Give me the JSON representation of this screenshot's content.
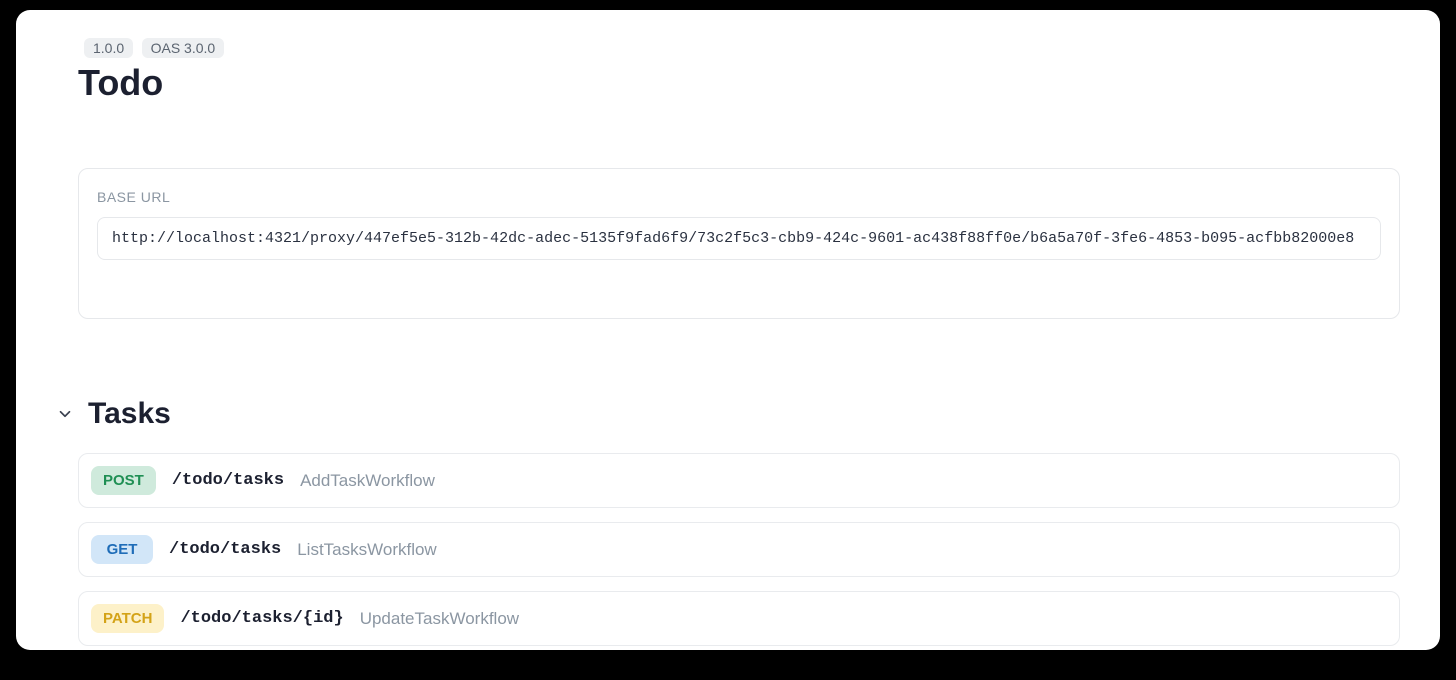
{
  "header": {
    "version_badge": "1.0.0",
    "oas_badge": "OAS 3.0.0",
    "title": "Todo"
  },
  "base_url": {
    "label": "BASE URL",
    "value": "http://localhost:4321/proxy/447ef5e5-312b-42dc-adec-5135f9fad6f9/73c2f5c3-cbb9-424c-9601-ac438f88ff0e/b6a5a70f-3fe6-4853-b095-acfbb82000e8"
  },
  "section": {
    "title": "Tasks"
  },
  "endpoints": [
    {
      "method": "POST",
      "path": "/todo/tasks",
      "operation": "AddTaskWorkflow"
    },
    {
      "method": "GET",
      "path": "/todo/tasks",
      "operation": "ListTasksWorkflow"
    },
    {
      "method": "PATCH",
      "path": "/todo/tasks/{id}",
      "operation": "UpdateTaskWorkflow"
    }
  ],
  "method_colors": {
    "POST": "#1f8f54",
    "GET": "#1f6db8",
    "PATCH": "#d4a318"
  }
}
